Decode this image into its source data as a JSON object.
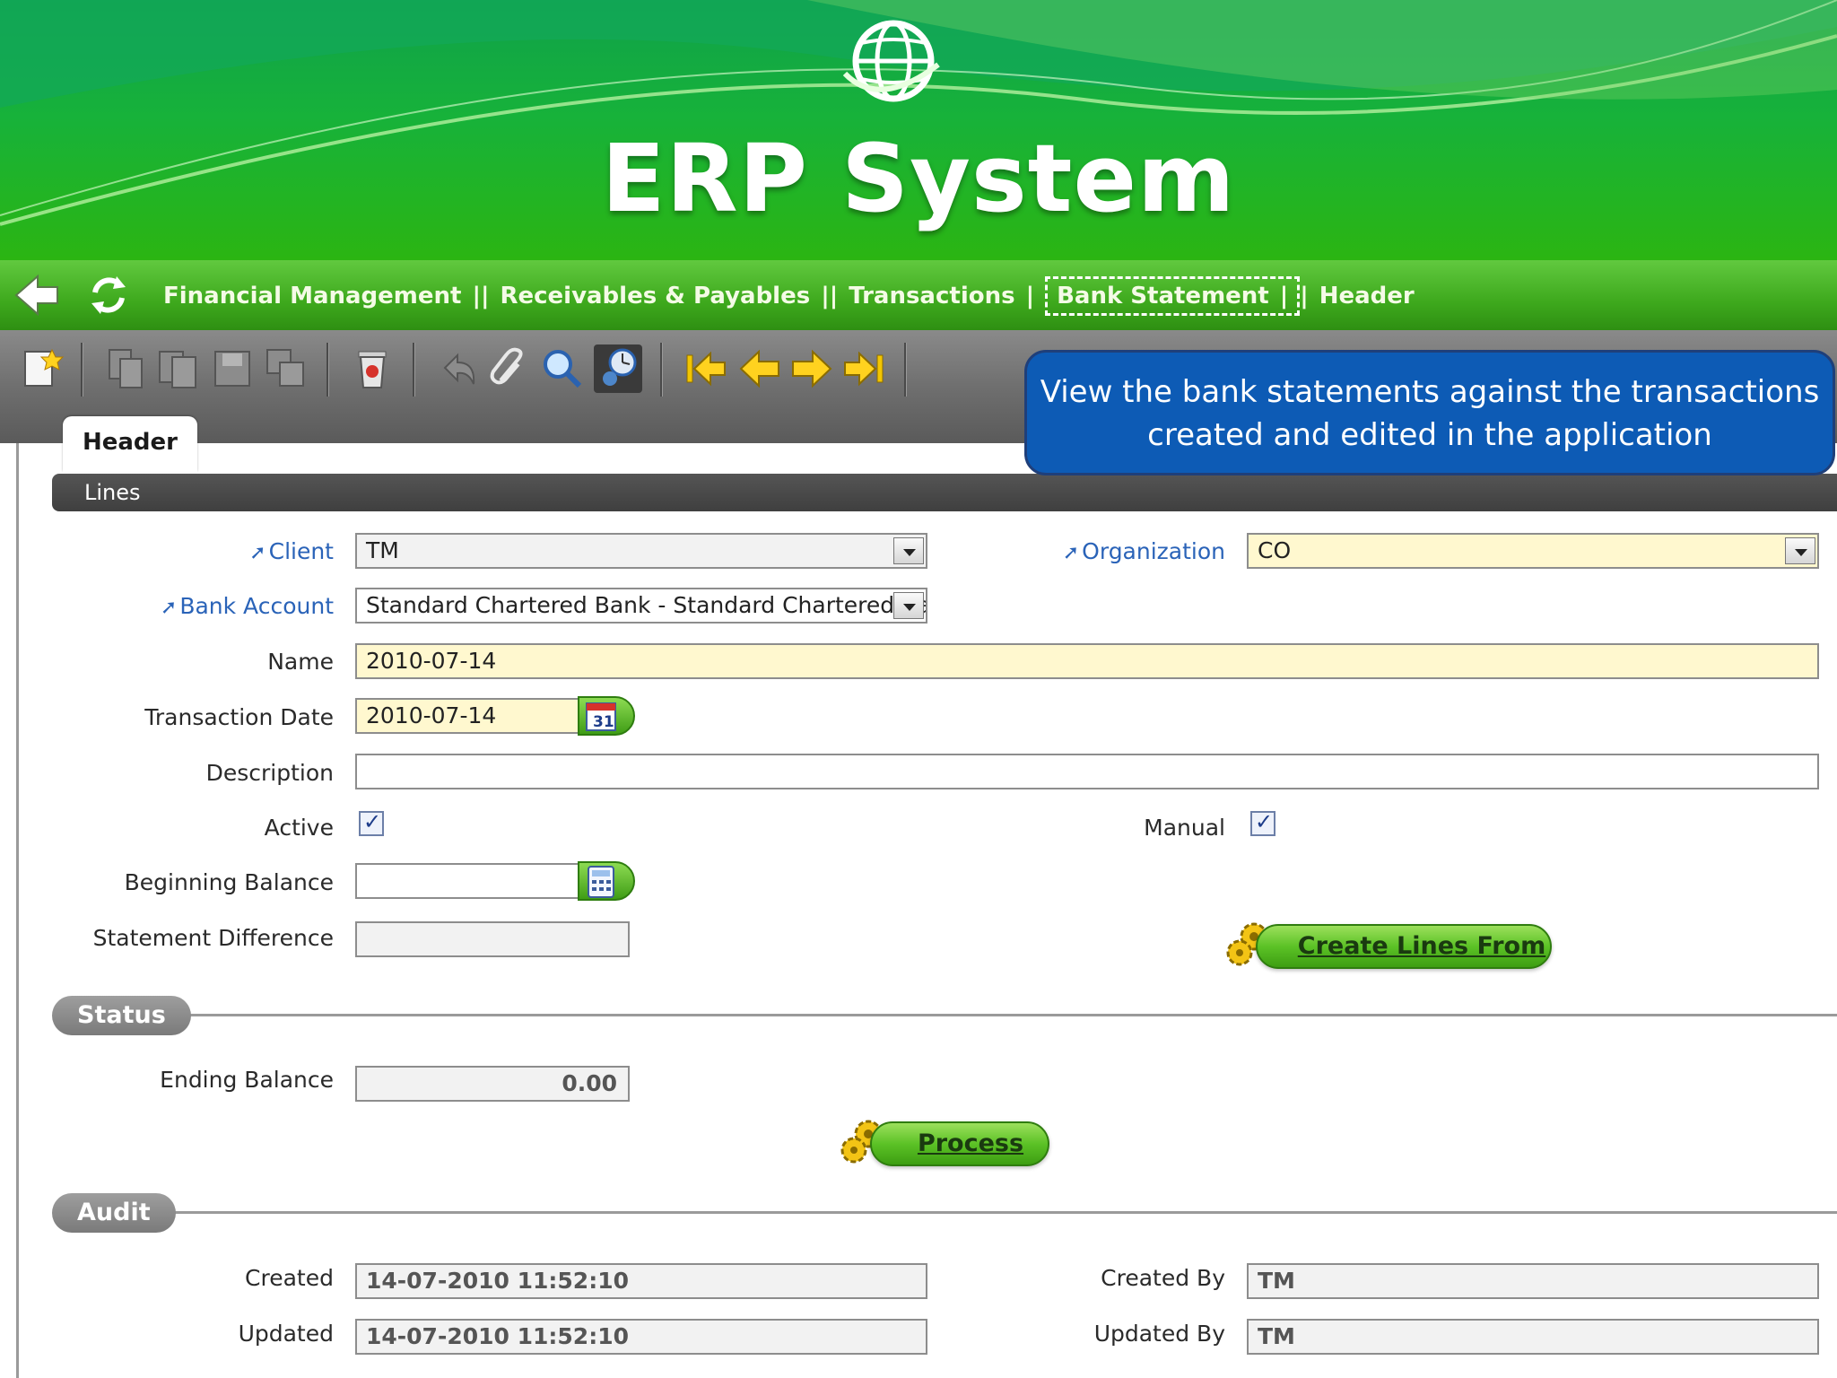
{
  "app": {
    "title": "ERP System"
  },
  "breadcrumb": {
    "items": [
      "Financial Management",
      "Receivables & Payables",
      "Transactions",
      "Bank Statement",
      "Header"
    ],
    "separator": "||"
  },
  "callout": {
    "line1": "View the bank statements against the transactions",
    "line2": "created and edited in the application"
  },
  "tabs": {
    "header": "Header",
    "lines": "Lines"
  },
  "form": {
    "client": {
      "label": "Client",
      "value": "TM"
    },
    "organization": {
      "label": "Organization",
      "value": "CO"
    },
    "bank_account": {
      "label": "Bank Account",
      "value": "Standard Chartered Bank - Standard Chartered Bank."
    },
    "name": {
      "label": "Name",
      "value": "2010-07-14"
    },
    "transaction_date": {
      "label": "Transaction Date",
      "value": "2010-07-14",
      "calendar_day": "31"
    },
    "description": {
      "label": "Description",
      "value": ""
    },
    "active": {
      "label": "Active",
      "checked": true
    },
    "manual": {
      "label": "Manual",
      "checked": true
    },
    "beginning_balance": {
      "label": "Beginning Balance",
      "value": ""
    },
    "statement_difference": {
      "label": "Statement Difference",
      "value": ""
    },
    "create_lines_from": "Create Lines From"
  },
  "status": {
    "title": "Status",
    "ending_balance": {
      "label": "Ending Balance",
      "value": "0.00"
    },
    "process": "Process"
  },
  "audit": {
    "title": "Audit",
    "created": {
      "label": "Created",
      "value": "14-07-2010 11:52:10"
    },
    "created_by": {
      "label": "Created By",
      "value": "TM"
    },
    "updated": {
      "label": "Updated",
      "value": "14-07-2010 11:52:10"
    },
    "updated_by": {
      "label": "Updated By",
      "value": "TM"
    }
  },
  "colors": {
    "banner_green": "#17b23a",
    "nav_green": "#3ea91d",
    "callout_blue": "#0d5bb5",
    "required_yellow": "#fff8cf"
  },
  "toolbar_icons": [
    "new-record-icon",
    "copy-icon",
    "copy-record-icon",
    "save-icon",
    "save-copy-icon",
    "delete-icon",
    "undo-icon",
    "attachment-icon",
    "search-icon",
    "history-icon",
    "first-record-icon",
    "previous-record-icon",
    "next-record-icon",
    "last-record-icon"
  ]
}
